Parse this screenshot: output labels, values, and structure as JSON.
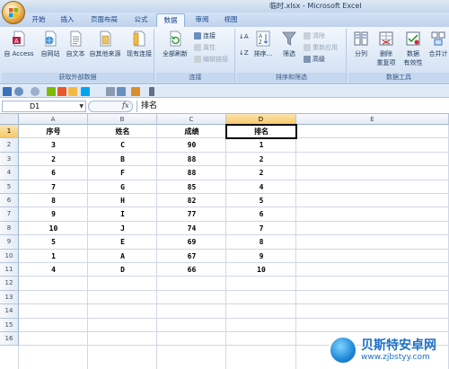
{
  "window": {
    "title": "临时.xlsx - Microsoft Excel"
  },
  "tabs": [
    {
      "label": "开始"
    },
    {
      "label": "插入"
    },
    {
      "label": "页面布局"
    },
    {
      "label": "公式"
    },
    {
      "label": "数据",
      "active": true
    },
    {
      "label": "审阅"
    },
    {
      "label": "视图"
    }
  ],
  "ribbon": {
    "groups": {
      "external": {
        "name": "获取外部数据",
        "from_access": "自 Access",
        "from_web": "自网站",
        "from_text": "自文本",
        "from_other": "自其他来源",
        "existing": "现有连接"
      },
      "connections": {
        "name": "连接",
        "refresh_all": "全部刷新",
        "connections": "连接",
        "properties": "属性",
        "edit_links": "编辑链接"
      },
      "sort_filter": {
        "name": "排序和筛选",
        "sort": "排序...",
        "filter": "筛选",
        "clear": "清除",
        "reapply": "重新应用",
        "advanced": "高级"
      },
      "data_tools": {
        "name": "数据工具",
        "text_to_columns": "分列",
        "remove_duplicates_1": "删除",
        "remove_duplicates_2": "重复项",
        "validation_1": "数据",
        "validation_2": "有效性",
        "consolidate": "合并计"
      }
    }
  },
  "formula_bar": {
    "name_box": "D1",
    "fx": "fx",
    "formula": "排名"
  },
  "sheet": {
    "columns": [
      "A",
      "B",
      "C",
      "D",
      "E"
    ],
    "selected_column": "D",
    "selected_cell": "D1",
    "rows": [
      {
        "n": "1",
        "cells": [
          "序号",
          "姓名",
          "成绩",
          "排名"
        ]
      },
      {
        "n": "2",
        "cells": [
          "3",
          "C",
          "90",
          "1"
        ]
      },
      {
        "n": "3",
        "cells": [
          "2",
          "B",
          "88",
          "2"
        ]
      },
      {
        "n": "4",
        "cells": [
          "6",
          "F",
          "88",
          "2"
        ]
      },
      {
        "n": "5",
        "cells": [
          "7",
          "G",
          "85",
          "4"
        ]
      },
      {
        "n": "6",
        "cells": [
          "8",
          "H",
          "82",
          "5"
        ]
      },
      {
        "n": "7",
        "cells": [
          "9",
          "I",
          "77",
          "6"
        ]
      },
      {
        "n": "8",
        "cells": [
          "10",
          "J",
          "74",
          "7"
        ]
      },
      {
        "n": "9",
        "cells": [
          "5",
          "E",
          "69",
          "8"
        ]
      },
      {
        "n": "10",
        "cells": [
          "1",
          "A",
          "67",
          "9"
        ]
      },
      {
        "n": "11",
        "cells": [
          "4",
          "D",
          "66",
          "10"
        ]
      },
      {
        "n": "12",
        "cells": [
          "",
          "",
          "",
          ""
        ]
      },
      {
        "n": "13",
        "cells": [
          "",
          "",
          "",
          ""
        ]
      },
      {
        "n": "14",
        "cells": [
          "",
          "",
          "",
          ""
        ]
      },
      {
        "n": "15",
        "cells": [
          "",
          "",
          "",
          ""
        ]
      },
      {
        "n": "16",
        "cells": [
          "",
          "",
          "",
          ""
        ]
      }
    ]
  },
  "watermark": {
    "title": "贝斯特安卓网",
    "url": "www.zjbstyy.com"
  },
  "colors": {
    "accent": "#15428b",
    "ribbon_bg": "#dce8f6",
    "selected_header": "#f8c96a",
    "grid_line": "#d0d7e5"
  }
}
